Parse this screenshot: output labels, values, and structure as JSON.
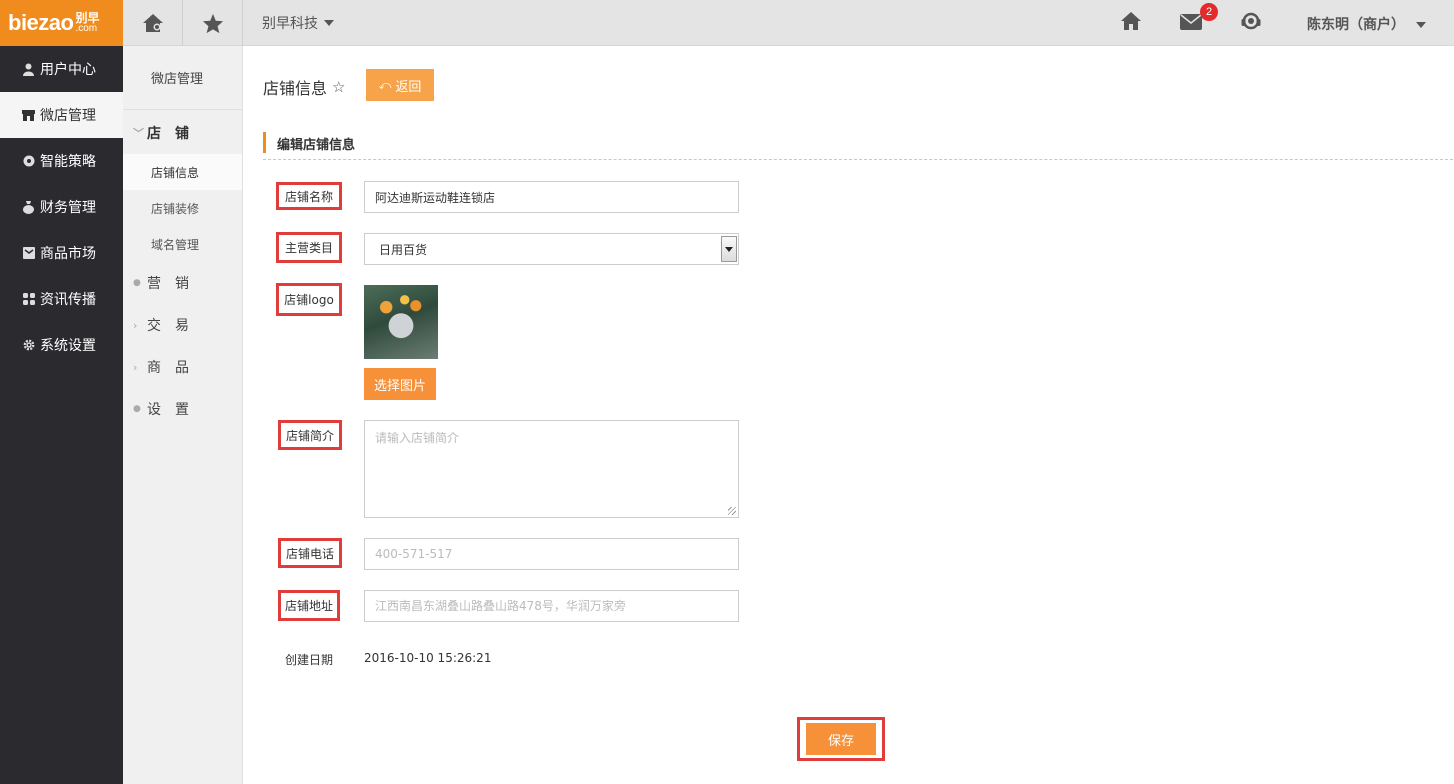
{
  "header": {
    "logo_text": "biezao",
    "logo_cn": "别早",
    "logo_com": ".com",
    "company": "别早科技",
    "mail_badge": "2",
    "user": "陈东明（商户）"
  },
  "leftnav": {
    "items": [
      {
        "label": "用户中心",
        "icon": "user-icon"
      },
      {
        "label": "微店管理",
        "icon": "shop-icon"
      },
      {
        "label": "智能策略",
        "icon": "strategy-icon"
      },
      {
        "label": "财务管理",
        "icon": "money-bag-icon"
      },
      {
        "label": "商品市场",
        "icon": "market-icon"
      },
      {
        "label": "资讯传播",
        "icon": "grid-icon"
      },
      {
        "label": "系统设置",
        "icon": "gear-icon"
      }
    ],
    "active": "微店管理"
  },
  "subnav": {
    "title": "微店管理",
    "group_open": "店　铺",
    "children": [
      "店铺信息",
      "店铺装修",
      "域名管理"
    ],
    "active_child": "店铺信息",
    "groups": [
      "营　销",
      "交　易",
      "商　品",
      "设　置"
    ]
  },
  "main": {
    "title": "店铺信息",
    "back_label": "返回",
    "section_title": "编辑店铺信息",
    "form": {
      "name_label": "店铺名称",
      "name_value": "阿达迪斯运动鞋连锁店",
      "category_label": "主营类目",
      "category_value": "日用百货",
      "logo_label": "店铺logo",
      "pick_label": "选择图片",
      "intro_label": "店铺简介",
      "intro_placeholder": "请输入店铺简介",
      "phone_label": "店铺电话",
      "phone_placeholder": "400-571-517",
      "address_label": "店铺地址",
      "address_placeholder": "江西南昌东湖叠山路叠山路478号，华润万家旁",
      "date_label": "创建日期",
      "date_value": "2016-10-10 15:26:21"
    },
    "save_label": "保存"
  },
  "colors": {
    "brand": "#f08c1e",
    "button": "#f6913a",
    "highlight": "#e03c3c",
    "sidebar": "#2b2a2f"
  }
}
